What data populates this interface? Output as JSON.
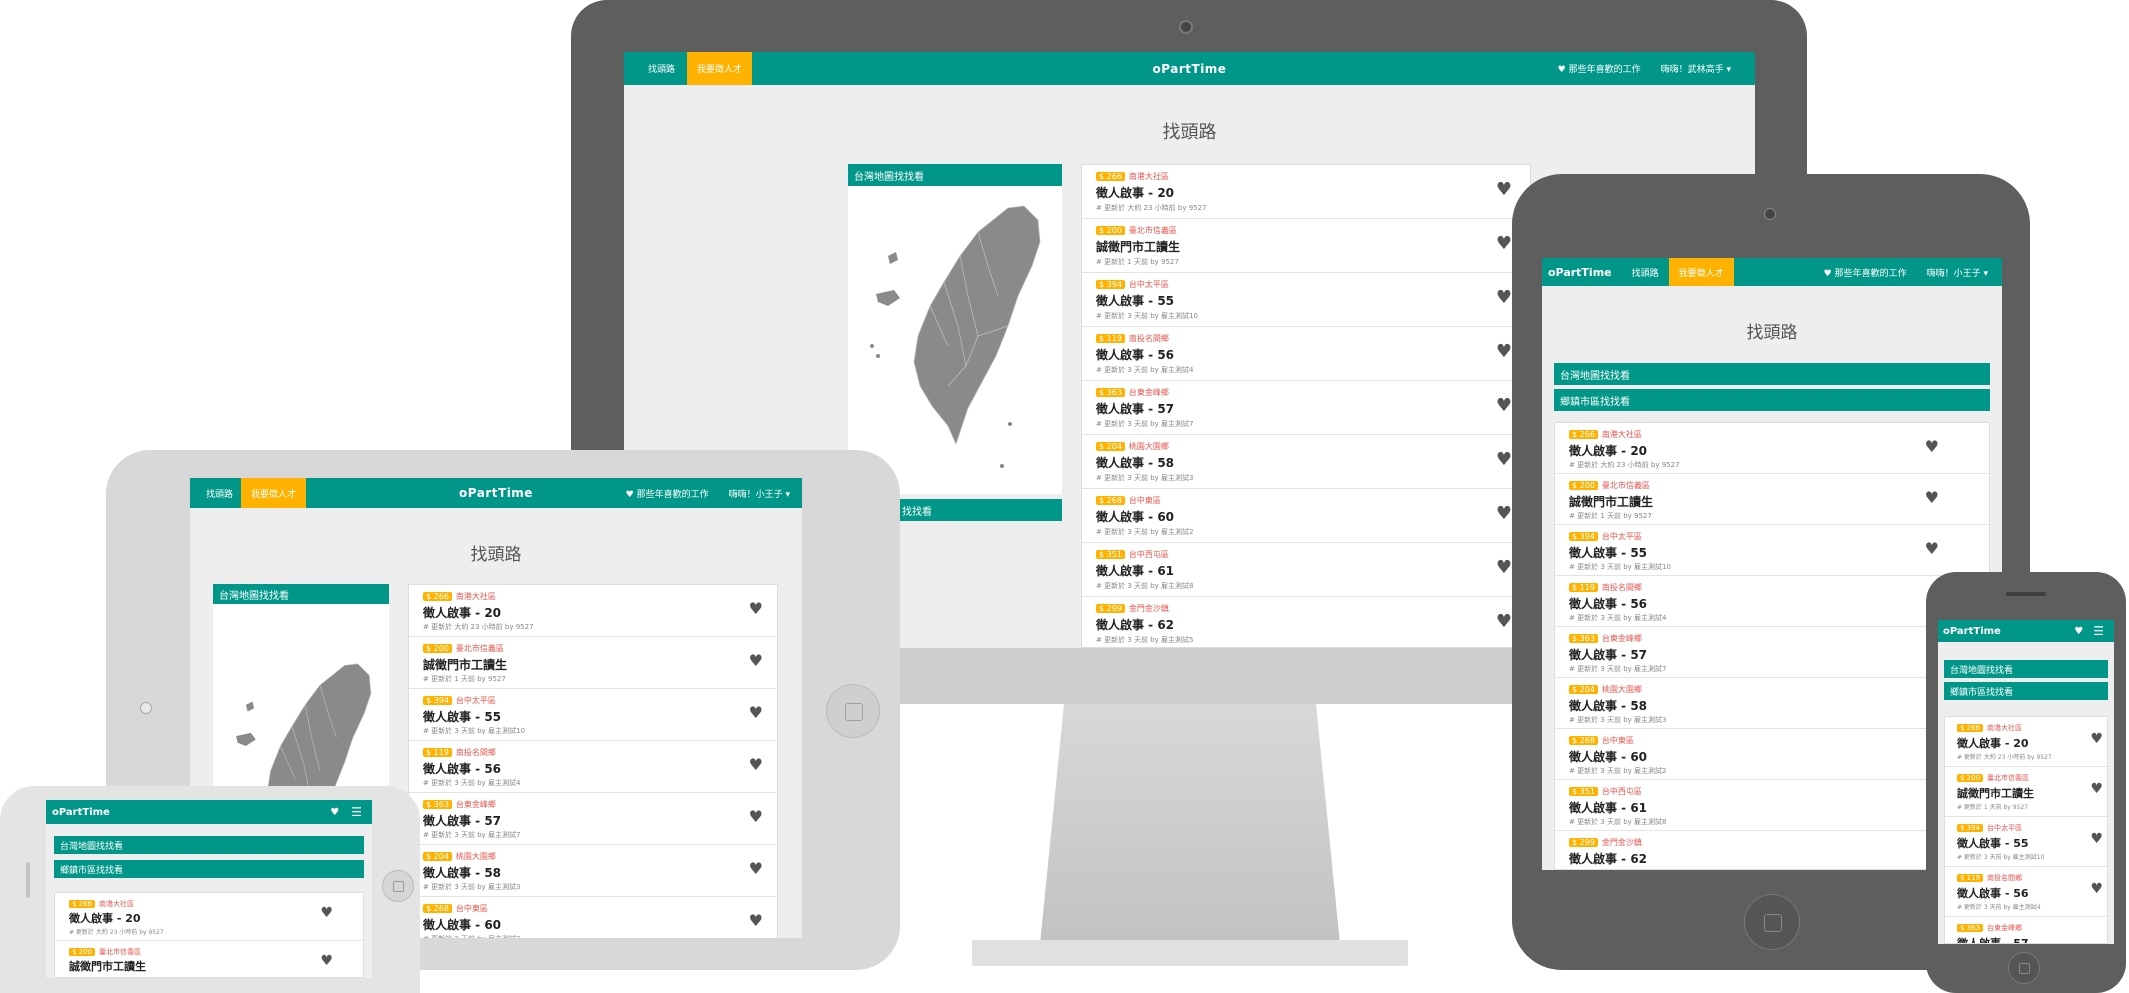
{
  "app": {
    "brand": "oPartTime",
    "nav_find_job": "找頭路",
    "nav_hire": "我要徵人才",
    "nav_favorites": "♥ 那些年喜歡的工作",
    "nav_user_imac": "嗨嗨！武林高手 ▾",
    "nav_user_tablet": "嗨嗨！小王子 ▾",
    "page_title": "找頭路",
    "panel_map": "台灣地圖找找看",
    "panel_district": "鄉鎮市區找找看",
    "panel_district_partial": "找找看"
  },
  "icons": {
    "heart": "heart-icon",
    "menu": "hamburger-menu-icon",
    "pin": "map-pin-icon"
  },
  "colors": {
    "primary": "#009688",
    "accent": "#ffb300",
    "location": "#e8554e"
  },
  "jobs": [
    {
      "salary": "$ 266",
      "location": "南港大社區",
      "title": "徵人啟事 - 20",
      "updated": "# 更新於 大約 23 小時前 by 9527"
    },
    {
      "salary": "$ 200",
      "location": "臺北市信義區",
      "title": "誠徵門市工讀生",
      "updated": "# 更新於 1 天前 by 9527"
    },
    {
      "salary": "$ 394",
      "location": "台中太平區",
      "title": "徵人啟事 - 55",
      "updated": "# 更新於 3 天前 by 雇主測試10"
    },
    {
      "salary": "$ 119",
      "location": "南投名間鄉",
      "title": "徵人啟事 - 56",
      "updated": "# 更新於 3 天前 by 雇主測試4"
    },
    {
      "salary": "$ 363",
      "location": "台東金峰鄉",
      "title": "徵人啟事 - 57",
      "updated": "# 更新於 3 天前 by 雇主測試7"
    },
    {
      "salary": "$ 204",
      "location": "桃園大園鄉",
      "title": "徵人啟事 - 58",
      "updated": "# 更新於 3 天前 by 雇主測試3"
    },
    {
      "salary": "$ 268",
      "location": "台中東區",
      "title": "徵人啟事 - 60",
      "updated": "# 更新於 3 天前 by 雇主測試2"
    },
    {
      "salary": "$ 351",
      "location": "台中西屯區",
      "title": "徵人啟事 - 61",
      "updated": "# 更新於 3 天前 by 雇主測試8"
    },
    {
      "salary": "$ 299",
      "location": "金門金沙鎮",
      "title": "徵人啟事 - 62",
      "updated": "# 更新於 3 天前 by 雇主測試5"
    }
  ]
}
